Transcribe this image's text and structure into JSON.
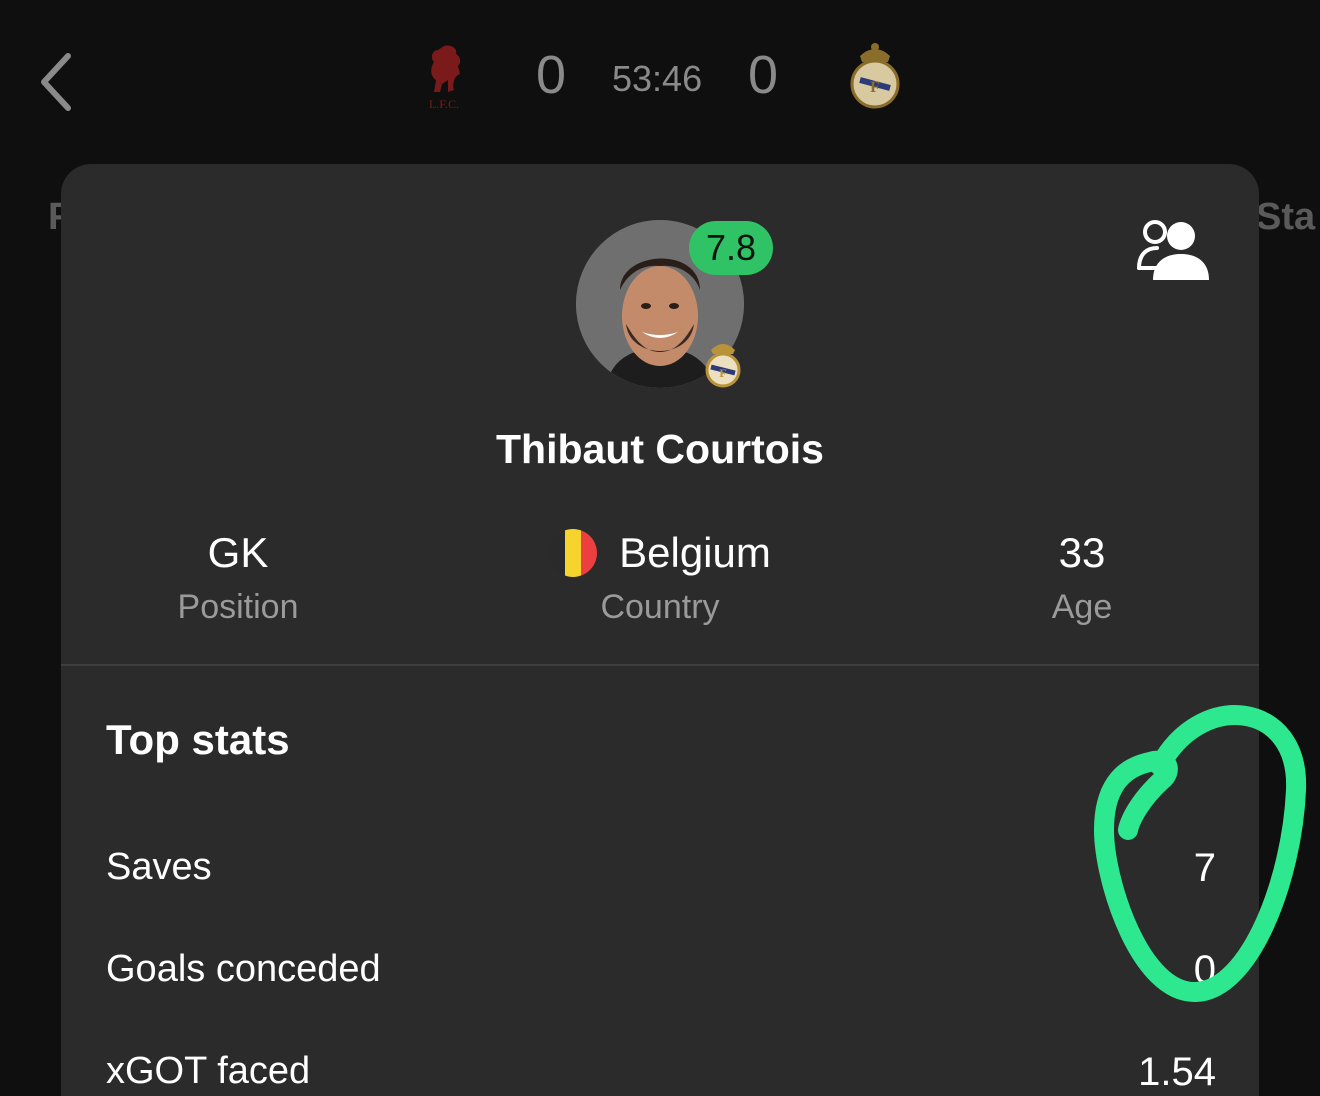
{
  "header": {
    "home_score": "0",
    "away_score": "0",
    "clock": "53:46",
    "home_team_crest": "liverpool-crest",
    "away_team_crest": "real-madrid-crest",
    "left_tab_fragment": "F",
    "right_tab_fragment": "Sta"
  },
  "player": {
    "name": "Thibaut Courtois",
    "rating": "7.8",
    "rating_color": "#2fc365",
    "team_crest": "real-madrid-crest",
    "position_value": "GK",
    "position_label": "Position",
    "country_value": "Belgium",
    "country_label": "Country",
    "age_value": "33",
    "age_label": "Age"
  },
  "top_stats": {
    "title": "Top stats",
    "rows": [
      {
        "label": "Saves",
        "value": "7"
      },
      {
        "label": "Goals conceded",
        "value": "0"
      },
      {
        "label": "xGOT faced",
        "value": "1.54"
      }
    ]
  },
  "annotation_color": "#2ee88f",
  "icons": {
    "back": "chevron-left-icon",
    "compare": "compare-players-icon"
  }
}
